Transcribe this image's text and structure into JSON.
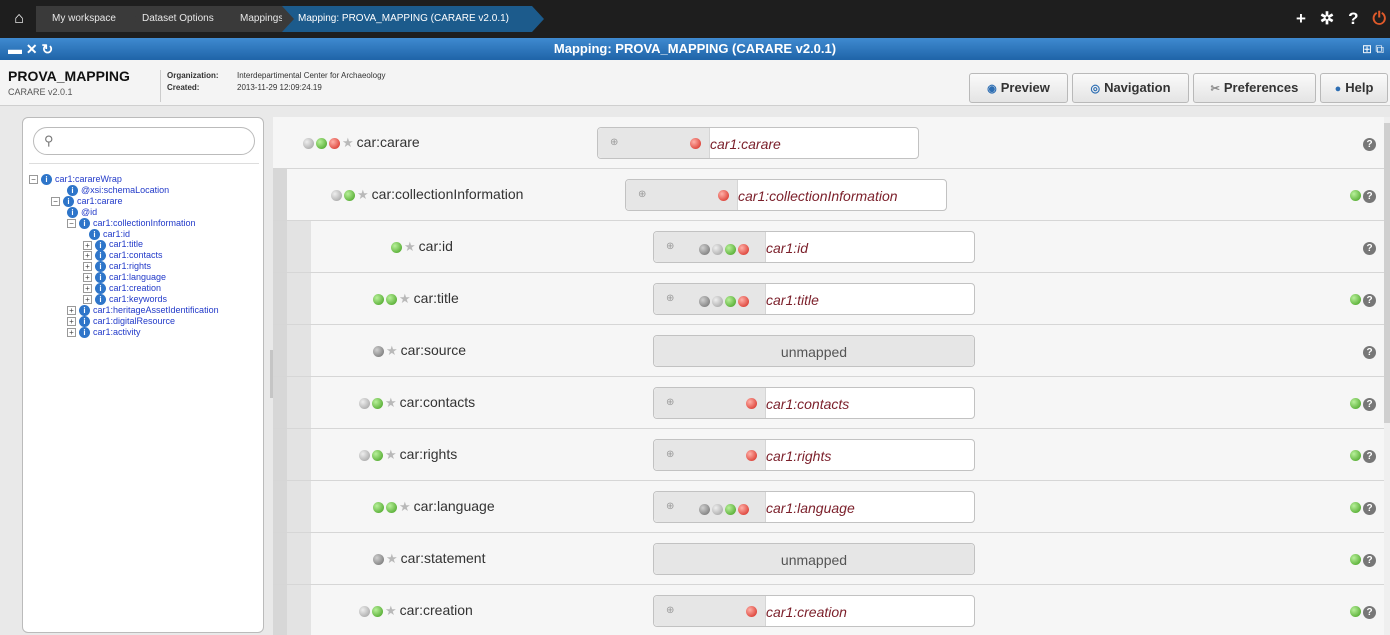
{
  "breadcrumb": [
    "My workspace",
    "Dataset Options",
    "Mappings",
    "Mapping: PROVA_MAPPING (CARARE v2.0.1)"
  ],
  "top_icons": [
    "plus-icon",
    "gear-icon",
    "help-icon",
    "power-icon"
  ],
  "window": {
    "title": "Mapping: PROVA_MAPPING (CARARE v2.0.1)",
    "controls": [
      "toggle-icon",
      "close-icon",
      "refresh-icon"
    ]
  },
  "info": {
    "name": "PROVA_MAPPING",
    "schema": "CARARE v2.0.1",
    "org_label": "Organization:",
    "org_value": "Interdepartimental Center for Archaeology",
    "created_label": "Created:",
    "created_value": "2013-11-29 12:09:24.19"
  },
  "buttons": {
    "preview": "Preview",
    "navigation": "Navigation",
    "preferences": "Preferences",
    "help": "Help"
  },
  "tree": [
    {
      "label": "car1:carareWrap",
      "toggle": "−",
      "icon": "i"
    },
    {
      "label": "@xsi:schemaLocation",
      "toggle": "",
      "icon": "i"
    },
    {
      "label": "car1:carare",
      "toggle": "−",
      "icon": "i"
    },
    {
      "label": "@id",
      "toggle": "",
      "icon": "i"
    },
    {
      "label": "car1:collectionInformation",
      "toggle": "−",
      "icon": "i"
    },
    {
      "label": "car1:id",
      "toggle": "",
      "icon": "i"
    },
    {
      "label": "car1:title",
      "toggle": "+",
      "icon": "i"
    },
    {
      "label": "car1:contacts",
      "toggle": "+",
      "icon": "i"
    },
    {
      "label": "car1:rights",
      "toggle": "+",
      "icon": "i"
    },
    {
      "label": "car1:language",
      "toggle": "+",
      "icon": "i"
    },
    {
      "label": "car1:creation",
      "toggle": "+",
      "icon": "i"
    },
    {
      "label": "car1:keywords",
      "toggle": "+",
      "icon": "i"
    },
    {
      "label": "car1:heritageAssetIdentification",
      "toggle": "+",
      "icon": "i"
    },
    {
      "label": "car1:digitalResource",
      "toggle": "+",
      "icon": "i"
    },
    {
      "label": "car1:activity",
      "toggle": "+",
      "icon": "i"
    }
  ],
  "mappings": [
    {
      "prefix": "car:",
      "name": "carare",
      "target": "car1:carare",
      "unmapped": false,
      "add": false
    },
    {
      "prefix": "car:",
      "name": "collectionInformation",
      "target": "car1:collectionInformation",
      "unmapped": false,
      "add": true
    },
    {
      "prefix": "car:",
      "name": "id",
      "target": "car1:id",
      "unmapped": false,
      "add": false
    },
    {
      "prefix": "car:",
      "name": "title",
      "target": "car1:title",
      "unmapped": false,
      "add": true
    },
    {
      "prefix": "car:",
      "name": "source",
      "target": "unmapped",
      "unmapped": true,
      "add": false
    },
    {
      "prefix": "car:",
      "name": "contacts",
      "target": "car1:contacts",
      "unmapped": false,
      "add": true
    },
    {
      "prefix": "car:",
      "name": "rights",
      "target": "car1:rights",
      "unmapped": false,
      "add": true
    },
    {
      "prefix": "car:",
      "name": "language",
      "target": "car1:language",
      "unmapped": false,
      "add": true
    },
    {
      "prefix": "car:",
      "name": "statement",
      "target": "unmapped",
      "unmapped": true,
      "add": true
    },
    {
      "prefix": "car:",
      "name": "creation",
      "target": "car1:creation",
      "unmapped": false,
      "add": true
    }
  ],
  "colors": {
    "accent": "#1f64a8",
    "mapped_text": "#7b1f2a",
    "add": "#4fa22b"
  }
}
